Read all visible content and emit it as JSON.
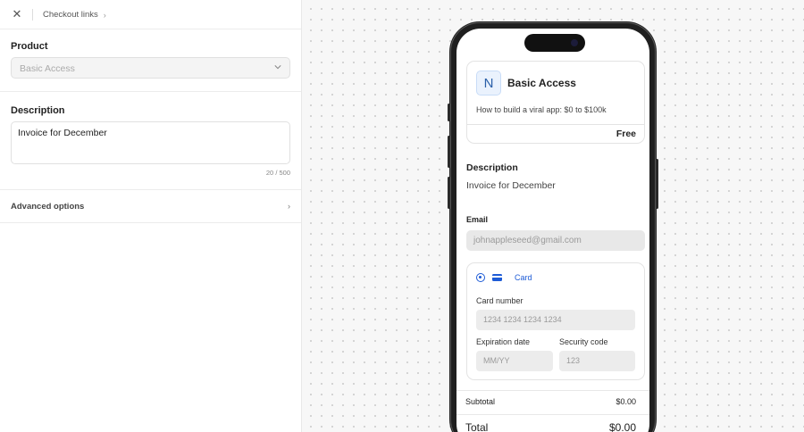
{
  "header": {
    "breadcrumb": "Checkout links"
  },
  "product": {
    "label": "Product",
    "selected": "Basic Access"
  },
  "description": {
    "label": "Description",
    "value": "Invoice for December",
    "counter": "20 / 500"
  },
  "advanced": {
    "label": "Advanced options"
  },
  "preview": {
    "avatar_letter": "N",
    "product_name": "Basic Access",
    "product_subtitle": "How to build a viral app: $0 to $100k",
    "price": "Free",
    "description_heading": "Description",
    "description_value": "Invoice for December",
    "email_label": "Email",
    "email_placeholder": "johnappleseed@gmail.com",
    "payment_method": "Card",
    "card_number_label": "Card number",
    "card_number_placeholder": "1234 1234 1234 1234",
    "expiration_label": "Expiration date",
    "expiration_placeholder": "MM/YY",
    "security_label": "Security code",
    "security_placeholder": "123",
    "subtotal_label": "Subtotal",
    "subtotal_value": "$0.00",
    "total_label": "Total",
    "total_value": "$0.00"
  },
  "colors": {
    "accent": "#1d5bd6",
    "avatar_bg": "#eaf2fd"
  }
}
